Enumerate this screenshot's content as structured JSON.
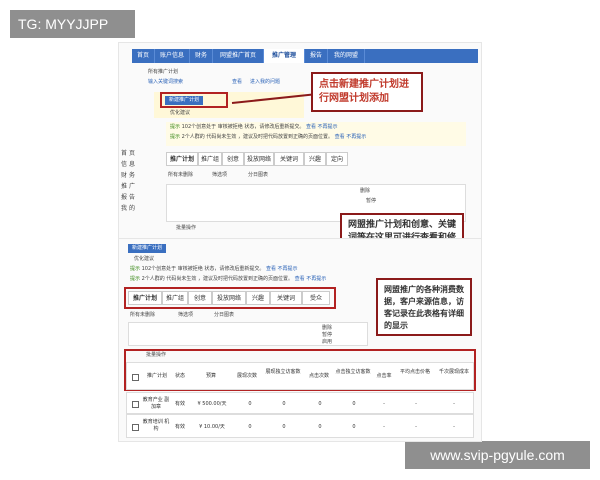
{
  "watermarks": {
    "top_left": "TG: MYYJJPP",
    "bottom_right": "www.svip-pgyule.com"
  },
  "nav": {
    "tabs": [
      "首页",
      "账户信息",
      "财务",
      "网盟推广首页",
      "推广管理",
      "报告",
      "我的网盟"
    ],
    "active_index": 4
  },
  "toolbar": {
    "new_plan_label": "所有推广计划",
    "search_placeholder": "输入关键词搜索",
    "search_link": "查看",
    "trial_link": "进入我的问题"
  },
  "left_sidebar": {
    "letters": [
      "首",
      "页",
      "信",
      "息",
      "财",
      "务",
      "推",
      "广",
      "报",
      "告",
      "我",
      "的"
    ]
  },
  "section1": {
    "new_plan_button": "新建推广计划",
    "optimize_hint": "优化建议",
    "notices": [
      {
        "tag": "提示",
        "text": "102个创意处于 审核被拒绝 状态，请修改后重新提交。",
        "link1": "查看",
        "link2": "不再提示"
      },
      {
        "tag": "提示",
        "text": "2个人群的 代码尚未生效 ，建议及时把代码放置到正确的页面位置。",
        "link1": "查看",
        "link2": "不再提示"
      }
    ],
    "subtabs": [
      "推广计划",
      "推广组",
      "创意",
      "投放网络",
      "关键词",
      "兴趣",
      "定向"
    ],
    "filters": {
      "status": "所有未删除",
      "filter": "筛选项",
      "daterange": "分日图表"
    },
    "delete_label": "删除",
    "pause_label": "暂停",
    "batch_label": "批量操作"
  },
  "callouts": {
    "c1": "点击新建推广计划进行网盟计划添加",
    "c2": "网盟推广计划和创意、关键词等在这里可进行查看和修改",
    "c3": "网盟推广的各种消费数据，客户来源信息，访客记录在此表格有详细的显示"
  },
  "section2": {
    "new_plan_button": "新建推广计划",
    "optimize_hint": "优化建议",
    "notices": [
      {
        "tag": "提示",
        "text": "102个创意处于 审核被拒绝 状态，请修改后重新提交。",
        "link1": "查看",
        "link2": "不再提示"
      },
      {
        "tag": "提示",
        "text": "2个人群的 代码尚未生效 ，建议及时把代码放置到正确的页面位置。",
        "link1": "查看",
        "link2": "不再提示"
      }
    ],
    "subtabs": [
      "推广计划",
      "推广组",
      "创意",
      "投放网络",
      "兴趣",
      "关键词",
      "受众"
    ],
    "filters": {
      "status": "所有未删除",
      "filter": "筛选项",
      "daterange": "分日图表"
    },
    "delete_label": "删除",
    "pause_label": "暂停",
    "enable_label": "启用",
    "batch_label": "批量操作",
    "table": {
      "headers": [
        "推广计划",
        "状态",
        "预算",
        "展现次数",
        "展现独立访客数",
        "点击次数",
        "点击独立访客数",
        "点击率",
        "平均点击价格",
        "千次展现成本"
      ],
      "rows": [
        {
          "name": "教育产业 副加章",
          "status": "有效",
          "budget": "¥ 500.00/天",
          "impr": "0",
          "uv": "0",
          "clicks": "0",
          "cuv": "0",
          "ctr": "-",
          "cpc": "-",
          "cpm": "-"
        },
        {
          "name": "教育培训 机构",
          "status": "有效",
          "budget": "¥ 10.00/天",
          "impr": "0",
          "uv": "0",
          "clicks": "0",
          "cuv": "0",
          "ctr": "-",
          "cpc": "-",
          "cpm": "-"
        }
      ]
    }
  },
  "colors": {
    "nav_blue": "#3a6fc0",
    "callout_border": "#8b1a1a",
    "callout_text": "#c0392b",
    "status_green": "#3b8a1a"
  }
}
